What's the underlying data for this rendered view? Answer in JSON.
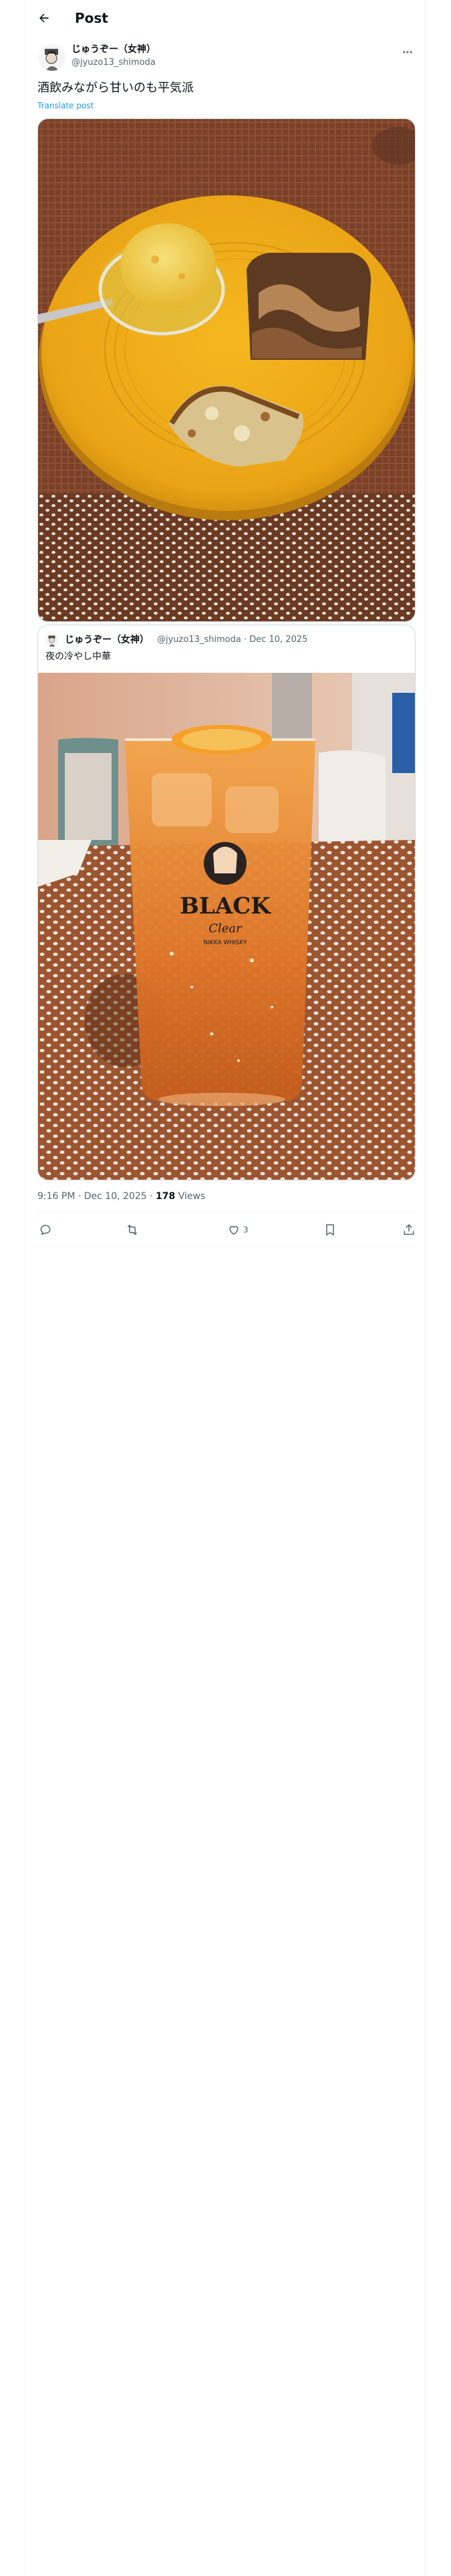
{
  "header": {
    "title": "Post"
  },
  "post": {
    "author_name": "じゅうぞー（女神）",
    "author_handle": "@jyuzo13_shimoda",
    "text": "酒飲みながら甘いのも平気派",
    "translate_label": "Translate post",
    "timestamp": "9:16 PM · Dec 10, 2025",
    "separator": " · ",
    "views_count": "178",
    "views_label": "Views"
  },
  "quote": {
    "author_name": "じゅうぞー（女神）",
    "meta": "@jyuzo13_shimoda · Dec 10, 2025",
    "text": "夜の冷やし中華",
    "glass_brand": "BLACK",
    "glass_script": "Clear",
    "glass_sub": "NIKKA WHISKY"
  },
  "actions": {
    "reply_count": "",
    "repost_count": "",
    "like_count": "3",
    "bookmark_count": ""
  },
  "colors": {
    "text": "#0f1419",
    "secondary": "#536471",
    "accent": "#1d9bf0",
    "border": "#cfd9de"
  }
}
